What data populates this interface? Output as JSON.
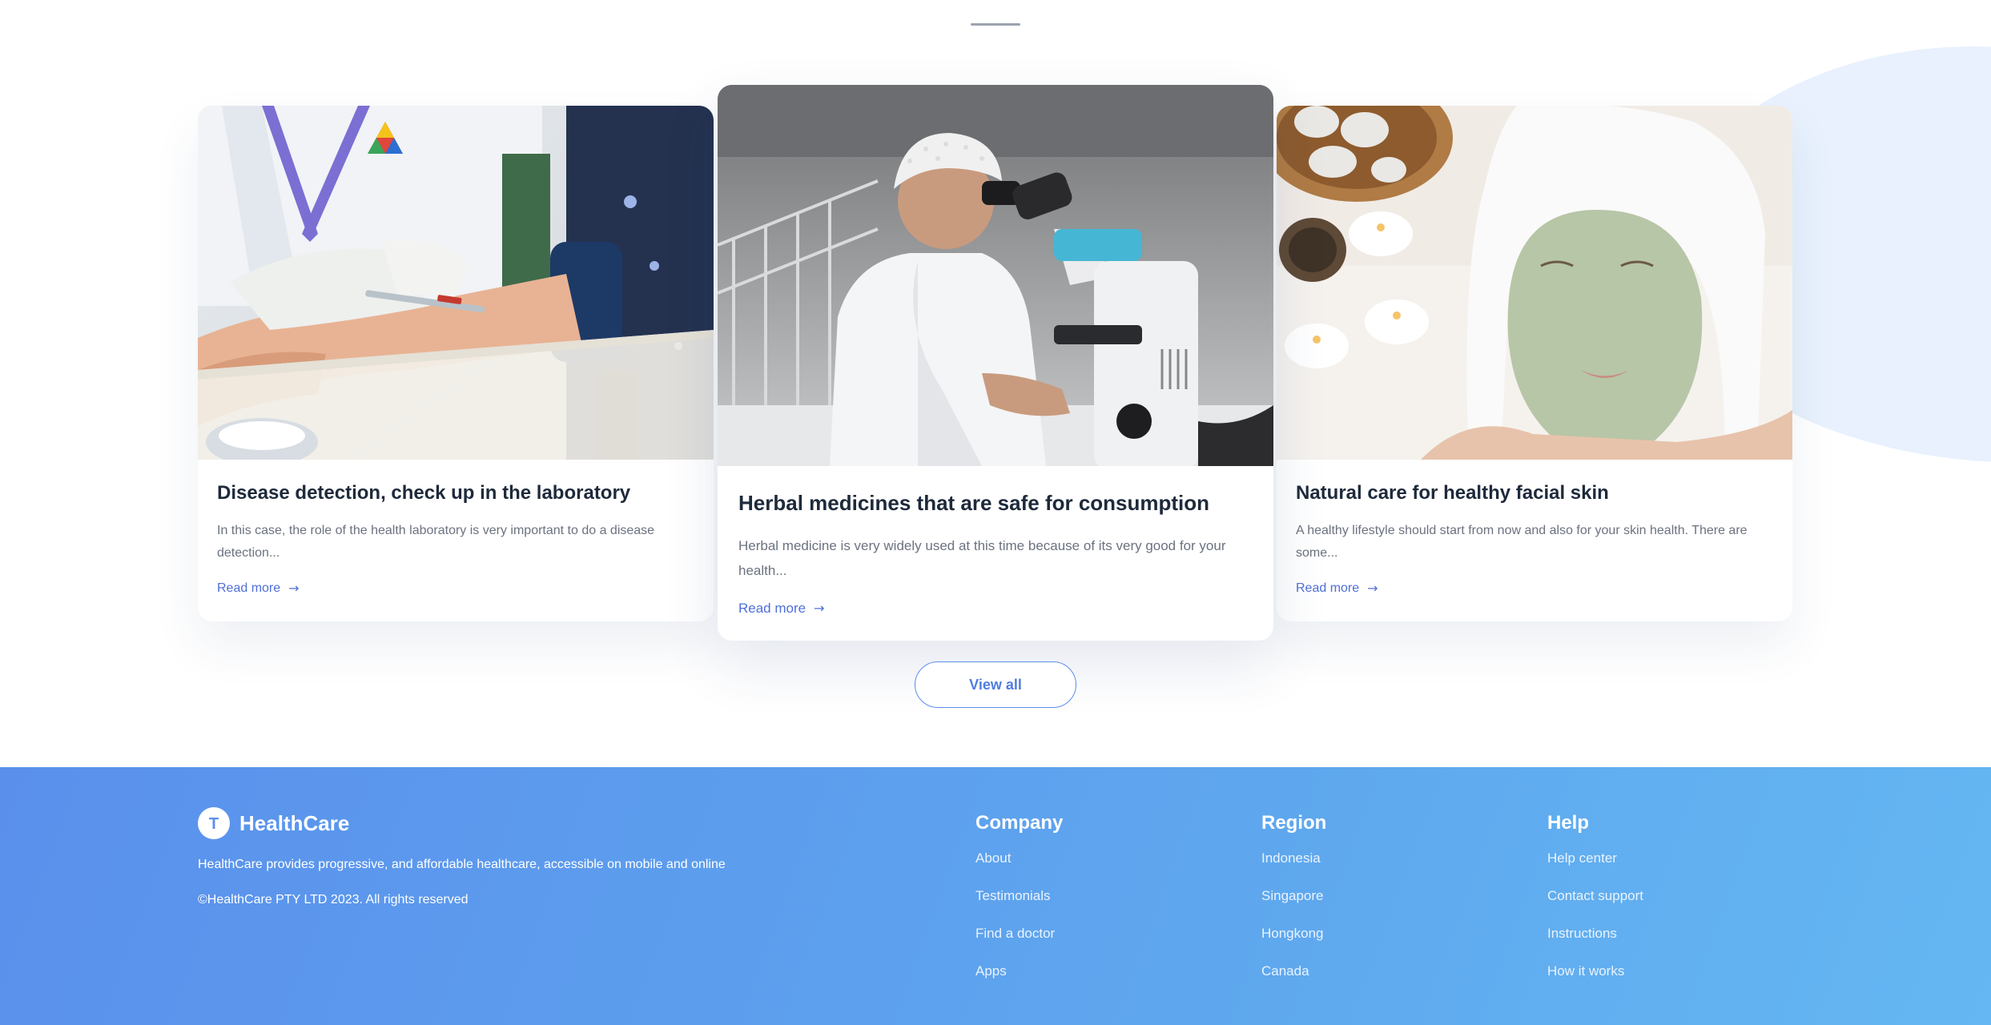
{
  "articles": [
    {
      "title": "Disease detection, check up in the laboratory",
      "excerpt": "In this case, the role of the health laboratory is very important to do a disease detection...",
      "read_more": "Read more",
      "image": "blood-test-photo"
    },
    {
      "title": "Herbal medicines that are safe for consumption",
      "excerpt": "Herbal medicine is very widely used at this time because of its very good for your health...",
      "read_more": "Read more",
      "image": "microscope-researcher-photo"
    },
    {
      "title": "Natural care for healthy facial skin",
      "excerpt": "A healthy lifestyle should start from now and also for your skin health. There are some...",
      "read_more": "Read more",
      "image": "facial-mask-spa-photo"
    }
  ],
  "view_all_label": "View all",
  "footer": {
    "brand_name": "HealthCare",
    "brand_logo_letter": "T",
    "description": "HealthCare provides progressive, and affordable healthcare, accessible on mobile and online",
    "copyright": "©HealthCare PTY LTD 2023. All rights reserved",
    "columns": [
      {
        "title": "Company",
        "links": [
          "About",
          "Testimonials",
          "Find a doctor",
          "Apps"
        ]
      },
      {
        "title": "Region",
        "links": [
          "Indonesia",
          "Singapore",
          "Hongkong",
          "Canada"
        ]
      },
      {
        "title": "Help",
        "links": [
          "Help center",
          "Contact support",
          "Instructions",
          "How it works"
        ]
      }
    ]
  },
  "colors": {
    "accent": "#4f6fd8",
    "footer_gradient_start": "#5a90ec",
    "footer_gradient_end": "#64b7f2",
    "title": "#1e2a3b",
    "muted": "#6b7280"
  },
  "icons": {
    "read_more": "arrow-right-icon",
    "logo": "healthcare-logo-icon"
  }
}
